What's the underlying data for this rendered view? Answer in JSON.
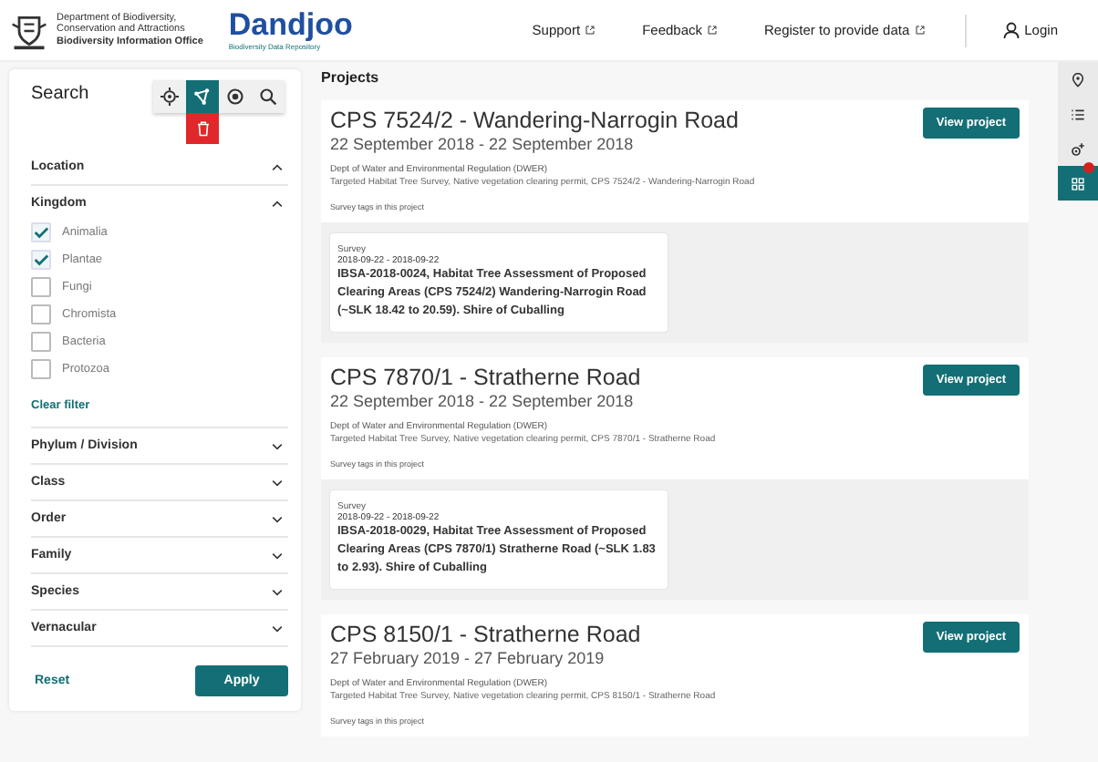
{
  "header": {
    "org_lines": [
      "Department of Biodiversity,",
      "Conservation and Attractions",
      "Biodiversity Information Office"
    ],
    "brand": "Dandjoo",
    "tagline": "Biodiversity Data Repository",
    "links": [
      {
        "label": "Support"
      },
      {
        "label": "Feedback"
      },
      {
        "label": "Register to provide data"
      }
    ],
    "login": "Login"
  },
  "sidebar": {
    "title": "Search",
    "tools": [
      {
        "kind": "locate",
        "selected": false
      },
      {
        "kind": "polygon",
        "selected": true
      },
      {
        "kind": "point",
        "selected": false
      },
      {
        "kind": "search",
        "selected": false
      }
    ],
    "sections": [
      {
        "label": "Location",
        "expanded": true
      },
      {
        "label": "Kingdom",
        "expanded": true,
        "options": [
          {
            "label": "Animalia",
            "checked": true
          },
          {
            "label": "Plantae",
            "checked": true
          },
          {
            "label": "Fungi",
            "checked": false
          },
          {
            "label": "Chromista",
            "checked": false
          },
          {
            "label": "Bacteria",
            "checked": false
          },
          {
            "label": "Protozoa",
            "checked": false
          }
        ],
        "clear": "Clear filter"
      },
      {
        "label": "Phylum / Division",
        "expanded": false
      },
      {
        "label": "Class",
        "expanded": false
      },
      {
        "label": "Order",
        "expanded": false
      },
      {
        "label": "Family",
        "expanded": false
      },
      {
        "label": "Species",
        "expanded": false
      },
      {
        "label": "Vernacular",
        "expanded": false
      }
    ],
    "reset": "Reset",
    "apply": "Apply"
  },
  "main": {
    "title": "Projects",
    "projects": [
      {
        "title": "CPS 7524/2 - Wandering-Narrogin Road",
        "dates": "22 September 2018 - 22 September 2018",
        "org": "Dept of Water and Environmental Regulation (DWER)",
        "description": "Targeted Habitat Tree Survey, Native vegetation clearing permit, CPS 7524/2 - Wandering-Narrogin Road",
        "tags_label": "Survey tags in this project",
        "view_label": "View project",
        "surveys": [
          {
            "type": "Survey",
            "dates": "2018-09-22 - 2018-09-22",
            "title": "IBSA-2018-0024, Habitat Tree Assessment of Proposed Clearing Areas (CPS 7524/2) Wandering-Narrogin Road (~SLK 18.42 to 20.59). Shire of Cuballing"
          }
        ]
      },
      {
        "title": "CPS 7870/1 - Stratherne Road",
        "dates": "22 September 2018 - 22 September 2018",
        "org": "Dept of Water and Environmental Regulation (DWER)",
        "description": "Targeted Habitat Tree Survey, Native vegetation clearing permit, CPS 7870/1 - Stratherne Road",
        "tags_label": "Survey tags in this project",
        "view_label": "View project",
        "surveys": [
          {
            "type": "Survey",
            "dates": "2018-09-22 - 2018-09-22",
            "title": "IBSA-2018-0029, Habitat Tree Assessment of Proposed Clearing Areas (CPS 7870/1) Stratherne Road (~SLK 1.83 to 2.93). Shire of Cuballing"
          }
        ]
      },
      {
        "title": "CPS 8150/1 - Stratherne Road",
        "dates": "27 February 2019 - 27 February 2019",
        "org": "Dept of Water and Environmental Regulation (DWER)",
        "description": "Targeted Habitat Tree Survey, Native vegetation clearing permit, CPS 8150/1 - Stratherne Road",
        "tags_label": "Survey tags in this project",
        "view_label": "View project"
      }
    ]
  },
  "rail": [
    {
      "kind": "pin",
      "selected": false,
      "badge": false
    },
    {
      "kind": "list",
      "selected": false,
      "badge": false
    },
    {
      "kind": "tools",
      "selected": false,
      "badge": false
    },
    {
      "kind": "grid",
      "selected": true,
      "badge": true
    }
  ]
}
